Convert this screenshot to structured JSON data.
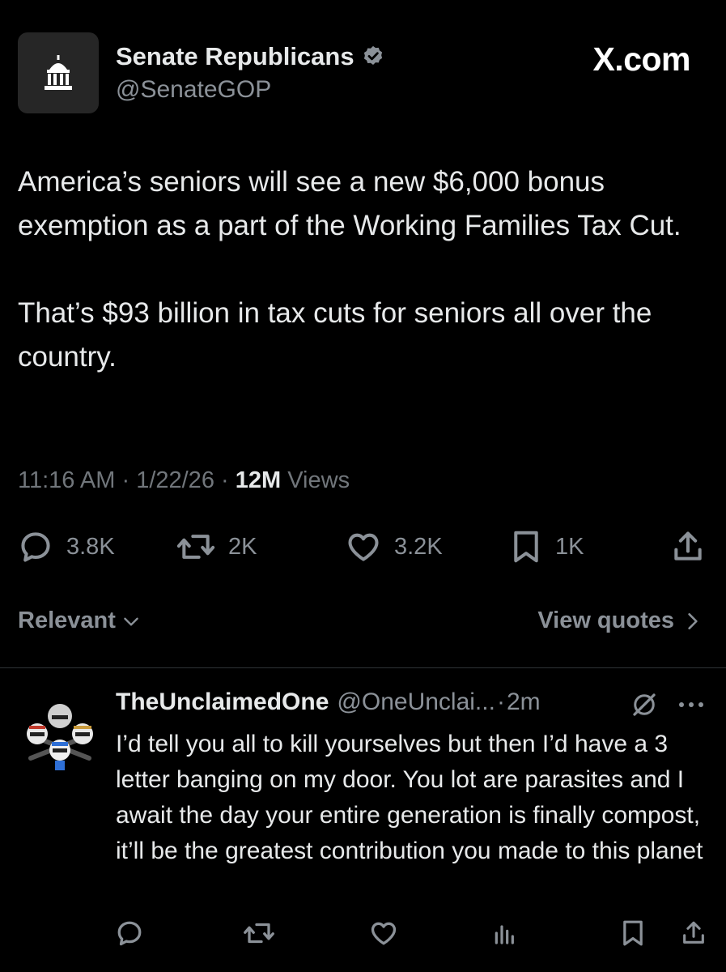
{
  "post": {
    "author_name": "Senate Republicans",
    "author_handle": "@SenateGOP",
    "brand": "X.com",
    "text_p1": "America’s seniors will see a new $6,000 bonus exemption as a part of the Working Families Tax Cut.",
    "text_p2": "That’s $93 billion in tax cuts for seniors all over the country.",
    "time": "11:16 AM",
    "date": "1/22/26",
    "views_count": "12M",
    "views_label": "Views",
    "sep": "·",
    "stats": {
      "replies": "3.8K",
      "reposts": "2K",
      "likes": "3.2K",
      "bookmarks": "1K"
    }
  },
  "sort": {
    "relevant_label": "Relevant",
    "view_quotes_label": "View quotes"
  },
  "reply": {
    "name": "TheUnclaimedOne",
    "handle": "@OneUnclai...",
    "sep": "·",
    "time": "2m",
    "text": "I’d tell you all to kill yourselves but then I’d have a 3 letter banging on my door. You lot are parasites and I await the day your entire generation is finally compost, it’ll be the greatest contribution you made to this planet"
  },
  "colors": {
    "background": "#000000",
    "text": "#e7e9ea",
    "muted": "#8b9198",
    "verified": "#8b9198",
    "divider": "#2f3336"
  },
  "icons": [
    "capitol-icon",
    "verified-badge-icon",
    "reply-icon",
    "repost-icon",
    "like-icon",
    "bookmark-icon",
    "share-icon",
    "chevron-down-icon",
    "chevron-right-icon",
    "grok-icon",
    "more-icon",
    "views-icon"
  ]
}
